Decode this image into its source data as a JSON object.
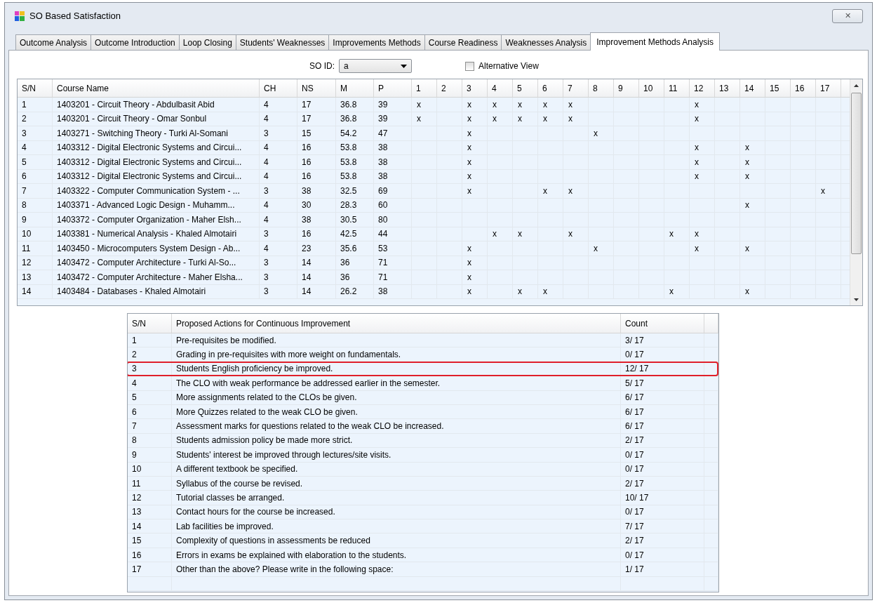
{
  "window": {
    "title": "SO Based Satisfaction",
    "close_label": "✕"
  },
  "tabs": [
    {
      "label": "Outcome Analysis",
      "selected": false
    },
    {
      "label": "Outcome Introduction",
      "selected": false
    },
    {
      "label": "Loop Closing",
      "selected": false
    },
    {
      "label": "Students' Weaknesses",
      "selected": false
    },
    {
      "label": "Improvements Methods",
      "selected": false
    },
    {
      "label": "Course Readiness",
      "selected": false
    },
    {
      "label": "Weaknesses Analysis",
      "selected": false
    },
    {
      "label": "Improvement Methods Analysis",
      "selected": true
    }
  ],
  "so_id": {
    "label": "SO ID:",
    "value": "a"
  },
  "alternative_view": {
    "label": "Alternative View",
    "checked": false
  },
  "courses_table": {
    "columns": [
      "S/N",
      "Course Name",
      "CH",
      "NS",
      "M",
      "P",
      "1",
      "2",
      "3",
      "4",
      "5",
      "6",
      "7",
      "8",
      "9",
      "10",
      "11",
      "12",
      "13",
      "14",
      "15",
      "16",
      "17"
    ],
    "rows": [
      {
        "sn": "1",
        "course": "1403201 - Circuit Theory - Abdulbasit Abid",
        "ch": "4",
        "ns": "17",
        "m": "36.8",
        "p": "39",
        "outcomes": [
          {
            "marked": true,
            "text": "x"
          },
          {
            "marked": false
          },
          {
            "marked": true,
            "text": "x"
          },
          {
            "marked": true,
            "text": "x"
          },
          {
            "marked": true,
            "text": "x"
          },
          {
            "marked": true,
            "text": "x"
          },
          {
            "marked": true,
            "text": "x"
          },
          {
            "marked": false
          },
          {
            "marked": false
          },
          {
            "marked": false
          },
          {
            "marked": false
          },
          {
            "marked": true,
            "text": "x"
          },
          {
            "marked": false
          },
          {
            "marked": false
          },
          {
            "marked": false
          },
          {
            "marked": false
          },
          {
            "marked": false
          }
        ]
      },
      {
        "sn": "2",
        "course": "1403201 - Circuit Theory - Omar  Sonbul",
        "ch": "4",
        "ns": "17",
        "m": "36.8",
        "p": "39",
        "outcomes": [
          {
            "marked": true,
            "text": "x"
          },
          {
            "marked": false
          },
          {
            "marked": true,
            "text": "x"
          },
          {
            "marked": true,
            "text": "x"
          },
          {
            "marked": true,
            "text": "x"
          },
          {
            "marked": true,
            "text": "x"
          },
          {
            "marked": true,
            "text": "x"
          },
          {
            "marked": false
          },
          {
            "marked": false
          },
          {
            "marked": false
          },
          {
            "marked": false
          },
          {
            "marked": true,
            "text": "x"
          },
          {
            "marked": false
          },
          {
            "marked": false
          },
          {
            "marked": false
          },
          {
            "marked": false
          },
          {
            "marked": false
          }
        ]
      },
      {
        "sn": "3",
        "course": "1403271 - Switching Theory -  Turki  Al-Somani",
        "ch": "3",
        "ns": "15",
        "m": "54.2",
        "p": "47",
        "outcomes": [
          {
            "marked": false
          },
          {
            "marked": false
          },
          {
            "marked": true,
            "text": "x"
          },
          {
            "marked": false
          },
          {
            "marked": false
          },
          {
            "marked": false
          },
          {
            "marked": false
          },
          {
            "marked": true,
            "text": "x"
          },
          {
            "marked": false
          },
          {
            "marked": false
          },
          {
            "marked": false
          },
          {
            "marked": false
          },
          {
            "marked": false
          },
          {
            "marked": false
          },
          {
            "marked": false
          },
          {
            "marked": false
          },
          {
            "marked": false
          }
        ]
      },
      {
        "sn": "4",
        "course": "1403312 - Digital Electronic Systems and Circui...",
        "ch": "4",
        "ns": "16",
        "m": "53.8",
        "p": "38",
        "outcomes": [
          {
            "marked": false
          },
          {
            "marked": false
          },
          {
            "marked": true,
            "text": "x"
          },
          {
            "marked": false
          },
          {
            "marked": false
          },
          {
            "marked": false
          },
          {
            "marked": false
          },
          {
            "marked": false
          },
          {
            "marked": false
          },
          {
            "marked": false
          },
          {
            "marked": false
          },
          {
            "marked": true,
            "text": "x"
          },
          {
            "marked": false
          },
          {
            "marked": true,
            "text": "x"
          },
          {
            "marked": false
          },
          {
            "marked": false
          },
          {
            "marked": false
          }
        ]
      },
      {
        "sn": "5",
        "course": "1403312 - Digital Electronic Systems and Circui...",
        "ch": "4",
        "ns": "16",
        "m": "53.8",
        "p": "38",
        "outcomes": [
          {
            "marked": false
          },
          {
            "marked": false
          },
          {
            "marked": true,
            "text": "x"
          },
          {
            "marked": false
          },
          {
            "marked": false
          },
          {
            "marked": false
          },
          {
            "marked": false
          },
          {
            "marked": false
          },
          {
            "marked": false
          },
          {
            "marked": false
          },
          {
            "marked": false
          },
          {
            "marked": true,
            "text": "x"
          },
          {
            "marked": false
          },
          {
            "marked": true,
            "text": "x"
          },
          {
            "marked": false
          },
          {
            "marked": false
          },
          {
            "marked": false
          }
        ]
      },
      {
        "sn": "6",
        "course": "1403312 - Digital Electronic Systems and Circui...",
        "ch": "4",
        "ns": "16",
        "m": "53.8",
        "p": "38",
        "outcomes": [
          {
            "marked": false
          },
          {
            "marked": false
          },
          {
            "marked": true,
            "text": "x"
          },
          {
            "marked": false
          },
          {
            "marked": false
          },
          {
            "marked": false
          },
          {
            "marked": false
          },
          {
            "marked": false
          },
          {
            "marked": false
          },
          {
            "marked": false
          },
          {
            "marked": false
          },
          {
            "marked": true,
            "text": "x"
          },
          {
            "marked": false
          },
          {
            "marked": true,
            "text": "x"
          },
          {
            "marked": false
          },
          {
            "marked": false
          },
          {
            "marked": false
          }
        ]
      },
      {
        "sn": "7",
        "course": "1403322 - Computer Communication System - ...",
        "ch": "3",
        "ns": "38",
        "m": "32.5",
        "p": "69",
        "outcomes": [
          {
            "marked": false
          },
          {
            "marked": false
          },
          {
            "marked": true,
            "text": "x"
          },
          {
            "marked": false
          },
          {
            "marked": false
          },
          {
            "marked": true,
            "text": "x"
          },
          {
            "marked": true,
            "text": "x"
          },
          {
            "marked": false
          },
          {
            "marked": false
          },
          {
            "marked": false
          },
          {
            "marked": false
          },
          {
            "marked": false
          },
          {
            "marked": false
          },
          {
            "marked": false
          },
          {
            "marked": false
          },
          {
            "marked": false
          },
          {
            "marked": true,
            "text": "x"
          }
        ]
      },
      {
        "sn": "8",
        "course": "1403371 - Advanced Logic Design -  Muhamm...",
        "ch": "4",
        "ns": "30",
        "m": "28.3",
        "p": "60",
        "outcomes": [
          {
            "marked": false
          },
          {
            "marked": false
          },
          {
            "marked": false
          },
          {
            "marked": false
          },
          {
            "marked": false
          },
          {
            "marked": false
          },
          {
            "marked": false
          },
          {
            "marked": false
          },
          {
            "marked": false
          },
          {
            "marked": false
          },
          {
            "marked": false
          },
          {
            "marked": false
          },
          {
            "marked": false
          },
          {
            "marked": true,
            "text": "x"
          },
          {
            "marked": false
          },
          {
            "marked": false
          },
          {
            "marked": false
          }
        ]
      },
      {
        "sn": "9",
        "course": "1403372 - Computer Organization - Maher Elsh...",
        "ch": "4",
        "ns": "38",
        "m": "30.5",
        "p": "80",
        "outcomes": [
          {
            "marked": false
          },
          {
            "marked": false
          },
          {
            "marked": false
          },
          {
            "marked": false
          },
          {
            "marked": false
          },
          {
            "marked": false
          },
          {
            "marked": false
          },
          {
            "marked": false
          },
          {
            "marked": false
          },
          {
            "marked": false
          },
          {
            "marked": false
          },
          {
            "marked": false
          },
          {
            "marked": false
          },
          {
            "marked": false
          },
          {
            "marked": false
          },
          {
            "marked": false
          },
          {
            "marked": false
          }
        ]
      },
      {
        "sn": "10",
        "course": "1403381 - Numerical Analysis - Khaled Almotairi",
        "ch": "3",
        "ns": "16",
        "m": "42.5",
        "p": "44",
        "outcomes": [
          {
            "marked": false
          },
          {
            "marked": false
          },
          {
            "marked": false
          },
          {
            "marked": true,
            "text": "x"
          },
          {
            "marked": true,
            "text": "x"
          },
          {
            "marked": false
          },
          {
            "marked": true,
            "text": "x"
          },
          {
            "marked": false
          },
          {
            "marked": false
          },
          {
            "marked": false
          },
          {
            "marked": true,
            "text": "x"
          },
          {
            "marked": true,
            "text": "x"
          },
          {
            "marked": false
          },
          {
            "marked": false
          },
          {
            "marked": false
          },
          {
            "marked": false
          },
          {
            "marked": false
          }
        ]
      },
      {
        "sn": "11",
        "course": "1403450 - Microcomputers System Design - Ab...",
        "ch": "4",
        "ns": "23",
        "m": "35.6",
        "p": "53",
        "outcomes": [
          {
            "marked": false
          },
          {
            "marked": false
          },
          {
            "marked": true,
            "text": "x"
          },
          {
            "marked": false
          },
          {
            "marked": false
          },
          {
            "marked": false
          },
          {
            "marked": false
          },
          {
            "marked": true,
            "text": "x"
          },
          {
            "marked": false
          },
          {
            "marked": false
          },
          {
            "marked": false
          },
          {
            "marked": true,
            "text": "x"
          },
          {
            "marked": false
          },
          {
            "marked": true,
            "text": "x"
          },
          {
            "marked": false
          },
          {
            "marked": false
          },
          {
            "marked": false
          }
        ]
      },
      {
        "sn": "12",
        "course": "1403472 - Computer Architecture - Turki  Al-So...",
        "ch": "3",
        "ns": "14",
        "m": "36",
        "p": "71",
        "outcomes": [
          {
            "marked": false
          },
          {
            "marked": false
          },
          {
            "marked": true,
            "text": "x"
          },
          {
            "marked": false
          },
          {
            "marked": false
          },
          {
            "marked": false
          },
          {
            "marked": false
          },
          {
            "marked": false
          },
          {
            "marked": false
          },
          {
            "marked": false
          },
          {
            "marked": false
          },
          {
            "marked": false
          },
          {
            "marked": false
          },
          {
            "marked": false
          },
          {
            "marked": false
          },
          {
            "marked": false
          },
          {
            "marked": false
          }
        ]
      },
      {
        "sn": "13",
        "course": "1403472 - Computer Architecture - Maher Elsha...",
        "ch": "3",
        "ns": "14",
        "m": "36",
        "p": "71",
        "outcomes": [
          {
            "marked": false
          },
          {
            "marked": false
          },
          {
            "marked": true,
            "text": "x"
          },
          {
            "marked": false
          },
          {
            "marked": false
          },
          {
            "marked": false
          },
          {
            "marked": false
          },
          {
            "marked": false
          },
          {
            "marked": false
          },
          {
            "marked": false
          },
          {
            "marked": false
          },
          {
            "marked": false
          },
          {
            "marked": false
          },
          {
            "marked": false
          },
          {
            "marked": false
          },
          {
            "marked": false
          },
          {
            "marked": false
          }
        ]
      },
      {
        "sn": "14",
        "course": "1403484 - Databases - Khaled Almotairi",
        "ch": "3",
        "ns": "14",
        "m": "26.2",
        "p": "38",
        "outcomes": [
          {
            "marked": false
          },
          {
            "marked": false
          },
          {
            "marked": true,
            "text": "x"
          },
          {
            "marked": false
          },
          {
            "marked": true,
            "text": "x"
          },
          {
            "marked": true,
            "text": "x"
          },
          {
            "marked": false
          },
          {
            "marked": false
          },
          {
            "marked": false
          },
          {
            "marked": false
          },
          {
            "marked": true,
            "text": "x"
          },
          {
            "marked": false
          },
          {
            "marked": false
          },
          {
            "marked": true,
            "text": "x"
          },
          {
            "marked": false
          },
          {
            "marked": false
          },
          {
            "marked": false
          }
        ]
      }
    ]
  },
  "actions_table": {
    "columns": [
      "S/N",
      "Proposed Actions for Continuous Improvement",
      "Count"
    ],
    "rows": [
      {
        "sn": "1",
        "action": "Pre-requisites be modified.",
        "count": "3/ 17",
        "highlighted": false
      },
      {
        "sn": "2",
        "action": "Grading in pre-requisites with more weight on fundamentals.",
        "count": "0/ 17",
        "highlighted": false
      },
      {
        "sn": "3",
        "action": "Students English proficiency be improved.",
        "count": "12/ 17",
        "highlighted": true
      },
      {
        "sn": "4",
        "action": "The CLO with weak performance be addressed earlier in the semester.",
        "count": "5/ 17",
        "highlighted": false
      },
      {
        "sn": "5",
        "action": "More assignments related to the CLOs be given.",
        "count": "6/ 17",
        "highlighted": false
      },
      {
        "sn": "6",
        "action": "More Quizzes related to the weak CLO be given.",
        "count": "6/ 17",
        "highlighted": false
      },
      {
        "sn": "7",
        "action": "Assessment marks for questions related to the weak CLO be increased.",
        "count": "6/ 17",
        "highlighted": false
      },
      {
        "sn": "8",
        "action": "Students admission policy be made more strict.",
        "count": "2/ 17",
        "highlighted": false
      },
      {
        "sn": "9",
        "action": "Students' interest be improved through lectures/site visits.",
        "count": "0/ 17",
        "highlighted": false
      },
      {
        "sn": "10",
        "action": "A different textbook be specified.",
        "count": "0/ 17",
        "highlighted": false
      },
      {
        "sn": "11",
        "action": "Syllabus of the course be revised.",
        "count": "2/ 17",
        "highlighted": false
      },
      {
        "sn": "12",
        "action": "Tutorial classes be arranged.",
        "count": "10/ 17",
        "highlighted": false
      },
      {
        "sn": "13",
        "action": "Contact hours for the course be increased.",
        "count": "0/ 17",
        "highlighted": false
      },
      {
        "sn": "14",
        "action": "Lab facilities be improved.",
        "count": "7/ 17",
        "highlighted": false
      },
      {
        "sn": "15",
        "action": "Complexity of questions in assessments be reduced",
        "count": "2/ 17",
        "highlighted": false
      },
      {
        "sn": "16",
        "action": "Errors in exams be explained with elaboration to the students.",
        "count": "0/ 17",
        "highlighted": false
      },
      {
        "sn": "17",
        "action": "Other than the above? Please write in the following space:",
        "count": "1/ 17",
        "highlighted": false
      }
    ]
  }
}
